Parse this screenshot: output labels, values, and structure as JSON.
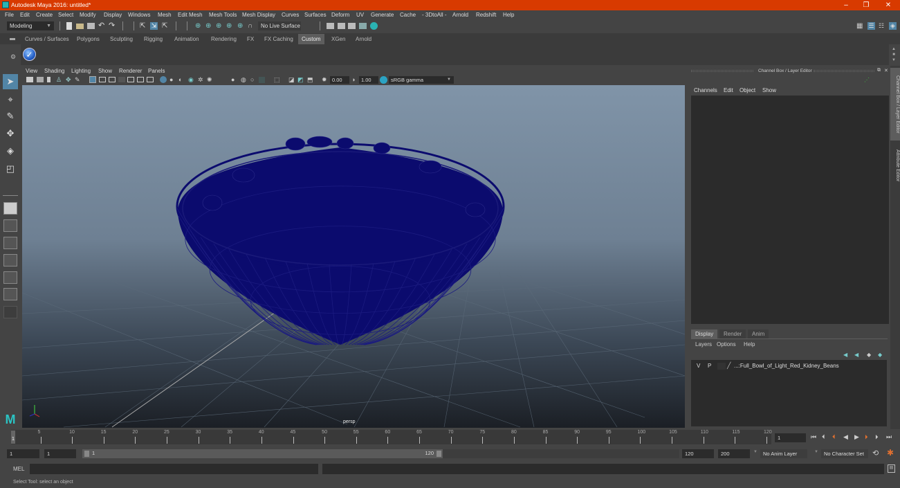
{
  "window": {
    "title": "Autodesk Maya 2016: untitled*",
    "controls": {
      "minimize": "–",
      "restore": "❐",
      "close": "✕"
    }
  },
  "menubar": [
    "File",
    "Edit",
    "Create",
    "Select",
    "Modify",
    "Display",
    "Windows",
    "Mesh",
    "Edit Mesh",
    "Mesh Tools",
    "Mesh Display",
    "Curves",
    "Surfaces",
    "Deform",
    "UV",
    "Generate",
    "Cache",
    "- 3DtoAll -",
    "Arnold",
    "Redshift",
    "Help"
  ],
  "statusline": {
    "workspace": "Modeling",
    "live_surface": "No Live Surface"
  },
  "shelf": {
    "tabs": [
      "Curves / Surfaces",
      "Polygons",
      "Sculpting",
      "Rigging",
      "Animation",
      "Rendering",
      "FX",
      "FX Caching",
      "Custom",
      "XGen",
      "Arnold"
    ],
    "active_tab": "Custom",
    "icons": [
      "checkmark-shelf-icon"
    ]
  },
  "toolbox": {
    "tools": [
      "select-tool",
      "lasso-tool",
      "paint-select-tool",
      "move-tool",
      "rotate-tool",
      "scale-tool"
    ],
    "active": "select-tool"
  },
  "viewport": {
    "menu": [
      "View",
      "Shading",
      "Lighting",
      "Show",
      "Renderer",
      "Panels"
    ],
    "exposure": "0.00",
    "gamma": "1.00",
    "color_space": "sRGB gamma",
    "camera": "persp",
    "wire_color": "#0b0b6e"
  },
  "channelbox": {
    "title": "Channel Box / Layer Editor",
    "menu": [
      "Channels",
      "Edit",
      "Object",
      "Show"
    ]
  },
  "layer_editor": {
    "tabs": [
      "Display",
      "Render",
      "Anim"
    ],
    "active_tab": "Display",
    "menu": [
      "Layers",
      "Options",
      "Help"
    ],
    "layers": [
      {
        "visible": "V",
        "playback": "P",
        "name": "...:Full_Bowl_of_Light_Red_Kidney_Beans"
      }
    ]
  },
  "side_tabs": [
    "Channel Box / Layer Editor",
    "Attribute Editor"
  ],
  "timeline": {
    "ticks": [
      "5",
      "10",
      "15",
      "20",
      "25",
      "30",
      "35",
      "40",
      "45",
      "50",
      "55",
      "60",
      "65",
      "70",
      "75",
      "80",
      "85",
      "90",
      "95",
      "100",
      "105",
      "110",
      "115",
      "120"
    ],
    "current_frame_marker": "1",
    "current_frame": "1"
  },
  "range": {
    "start": "1",
    "anim_start": "1",
    "slider_start": "1",
    "slider_end": "120",
    "end": "120",
    "anim_end": "200",
    "anim_layer": "No Anim Layer",
    "character_set": "No Character Set"
  },
  "cmdline": {
    "label": "MEL",
    "value": ""
  },
  "helpline": {
    "text": "Select Tool: select an object"
  }
}
